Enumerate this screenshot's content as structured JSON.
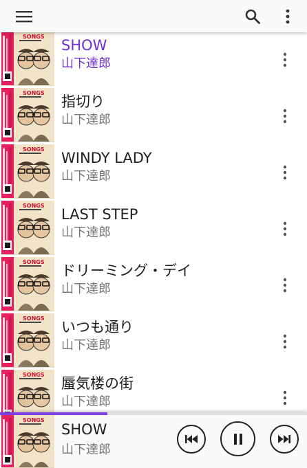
{
  "toolbar": {
    "menu_icon": "menu-icon",
    "search_icon": "search-icon",
    "more_icon": "more-vert-icon"
  },
  "songs": [
    {
      "title": "SHOW",
      "artist": "山下達郎",
      "active": true
    },
    {
      "title": "指切り",
      "artist": "山下達郎",
      "active": false
    },
    {
      "title": "WINDY LADY",
      "artist": "山下達郎",
      "active": false
    },
    {
      "title": "LAST STEP",
      "artist": "山下達郎",
      "active": false
    },
    {
      "title": "ドリーミング・デイ",
      "artist": "山下達郎",
      "active": false
    },
    {
      "title": "いつも通り",
      "artist": "山下達郎",
      "active": false
    },
    {
      "title": "蜃気楼の街",
      "artist": "山下達郎",
      "active": false
    }
  ],
  "now_playing": {
    "title": "SHOW",
    "artist": "山下達郎",
    "progress": 0.35
  },
  "colors": {
    "accent": "#6f2fd6",
    "progress": "#7b3fe4",
    "album_pink": "#e8205f",
    "album_tan": "#efe1c6"
  }
}
